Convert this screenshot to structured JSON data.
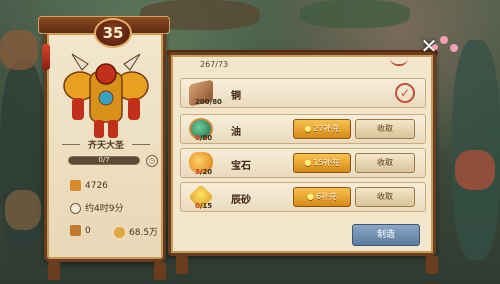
{
  "hero": {
    "level": "35",
    "name": "齐天大圣",
    "progress_text": "0/7",
    "progress": 0.0,
    "power": "4726",
    "time": "约4时9分",
    "chest_count": "0",
    "coins": "68.5万"
  },
  "list": {
    "prev_qty": "267/73",
    "items": [
      {
        "name": "铜",
        "qty_cur": "200",
        "qty_need": "80",
        "status": "done",
        "icon": "copper-icon"
      },
      {
        "name": "油",
        "qty_cur": "0",
        "qty_need": "80",
        "refill": "27补充",
        "collect": "收取",
        "icon": "oil-icon"
      },
      {
        "name": "宝石",
        "qty_cur": "3",
        "qty_need": "20",
        "refill": "15补充",
        "collect": "收取",
        "icon": "gem-icon"
      },
      {
        "name": "辰砂",
        "qty_cur": "0",
        "qty_need": "15",
        "refill": "6补充",
        "collect": "收取",
        "icon": "cinnabar-icon"
      }
    ],
    "make_label": "制造"
  },
  "colors": {
    "frame": "#6a3d1f",
    "parchment": "#f2e7cc",
    "refill_gold": "#f8c250",
    "make_blue": "#5a7ca0"
  }
}
